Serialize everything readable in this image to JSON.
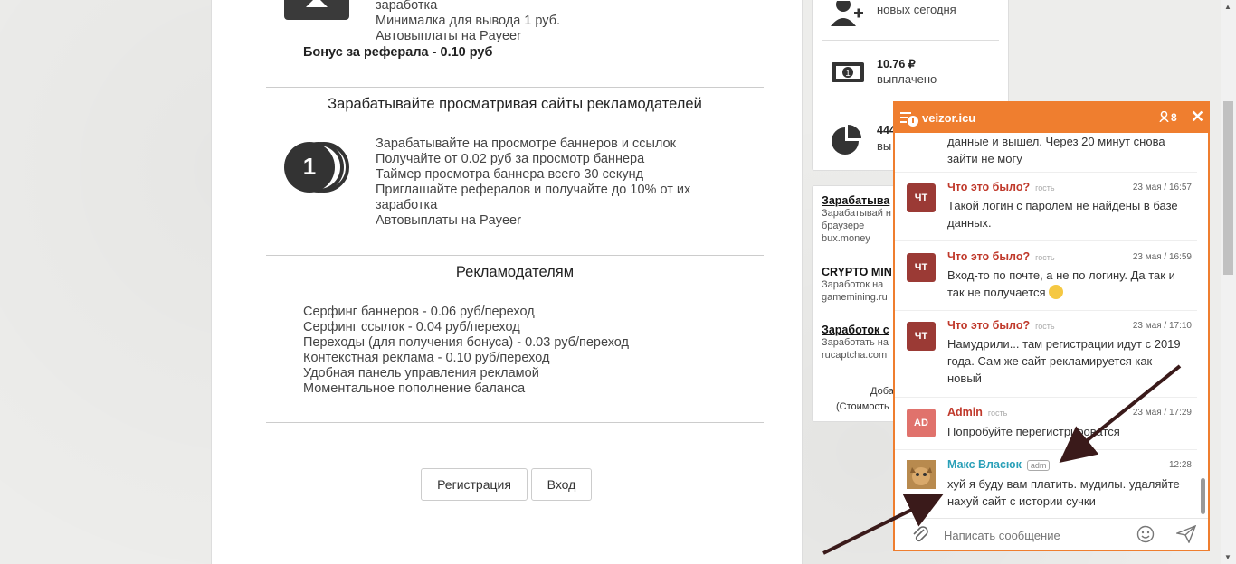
{
  "section1": {
    "lines": [
      "заработка",
      "Минималка для вывода 1 руб.",
      "Автовыплаты на Payeer"
    ],
    "bonus": "Бонус за реферала - 0.10 руб"
  },
  "section2": {
    "title": "Зарабатывайте просматривая сайты рекламодателей",
    "lines": [
      "Зарабатывайте на просмотре баннеров и ссылок",
      "Получайте от 0.02 руб за просмотр баннера",
      "Таймер просмотра баннера всего 30 секунд",
      "Приглашайте рефералов и получайте до 10% от их",
      "заработка",
      "Автовыплаты на Payeer"
    ],
    "icon_number": "1"
  },
  "section3": {
    "title": "Рекламодателям",
    "lines": [
      "Серфинг баннеров - 0.06 руб/переход",
      "Серфинг ссылок - 0.04 руб/переход",
      "Переходы (для получения бонуса) - 0.03 руб/переход",
      "Контекстная реклама - 0.10 руб/переход",
      "Удобная панель управления рекламой",
      "Моментальное пополнение баланса"
    ]
  },
  "buttons": {
    "register": "Регистрация",
    "login": "Вход"
  },
  "stats": [
    {
      "value": "",
      "label": "новых сегодня"
    },
    {
      "value": "10.76 ₽",
      "label": "выплачено"
    },
    {
      "value": "444",
      "label": "вы"
    }
  ],
  "ads": [
    {
      "title": "Зарабатыва",
      "desc": [
        "Зарабатывай н",
        "браузере"
      ],
      "url": "bux.money"
    },
    {
      "title": "CRYPTO MIN",
      "desc": [
        "Заработок на"
      ],
      "url": "gamemining.ru"
    },
    {
      "title": "Заработок с",
      "desc": [
        "Заработать на"
      ],
      "url": "rucaptcha.com"
    }
  ],
  "ads_footer": [
    "Доба",
    "(Стоимость"
  ],
  "chat": {
    "site": "veizor.icu",
    "online_count": "8",
    "partial_text": [
      "данные и вышел. Через 20 минут снова",
      "зайти не могу"
    ],
    "messages": [
      {
        "avatar": "ЧТ",
        "name": "Что это было?",
        "role": "гость",
        "time": "23 мая / 16:57",
        "text": [
          "Такой логин с паролем не найдены в базе",
          "данных."
        ]
      },
      {
        "avatar": "ЧТ",
        "name": "Что это было?",
        "role": "гость",
        "time": "23 мая / 16:59",
        "text": [
          "Вход-то по почте, а не по логину. Да так и",
          "так не получается"
        ]
      },
      {
        "avatar": "ЧТ",
        "name": "Что это было?",
        "role": "гость",
        "time": "23 мая / 17:10",
        "text": [
          "Намудрили... там регистрации идут с 2019",
          "года. Сам же сайт рекламируется как",
          "новый"
        ]
      },
      {
        "avatar": "AD",
        "name": "Admin",
        "role": "гость",
        "time": "23 мая / 17:29",
        "text": [
          "Попробуйте перегистрироватся"
        ]
      },
      {
        "avatar": "",
        "name": "Макс Власюк",
        "role": "adm",
        "time": "12:28",
        "text": [
          "хуй я буду вам платить. мудилы. удаляйте",
          "нахуй сайт с истории сучки"
        ]
      }
    ],
    "input_placeholder": "Написать сообщение"
  },
  "colors": {
    "accent": "#ef7e2f",
    "guest_name": "#c0392b",
    "admin_name": "#2aa0b8",
    "avatar_dark": "#9b3a35",
    "avatar_admin": "#e0726c"
  }
}
